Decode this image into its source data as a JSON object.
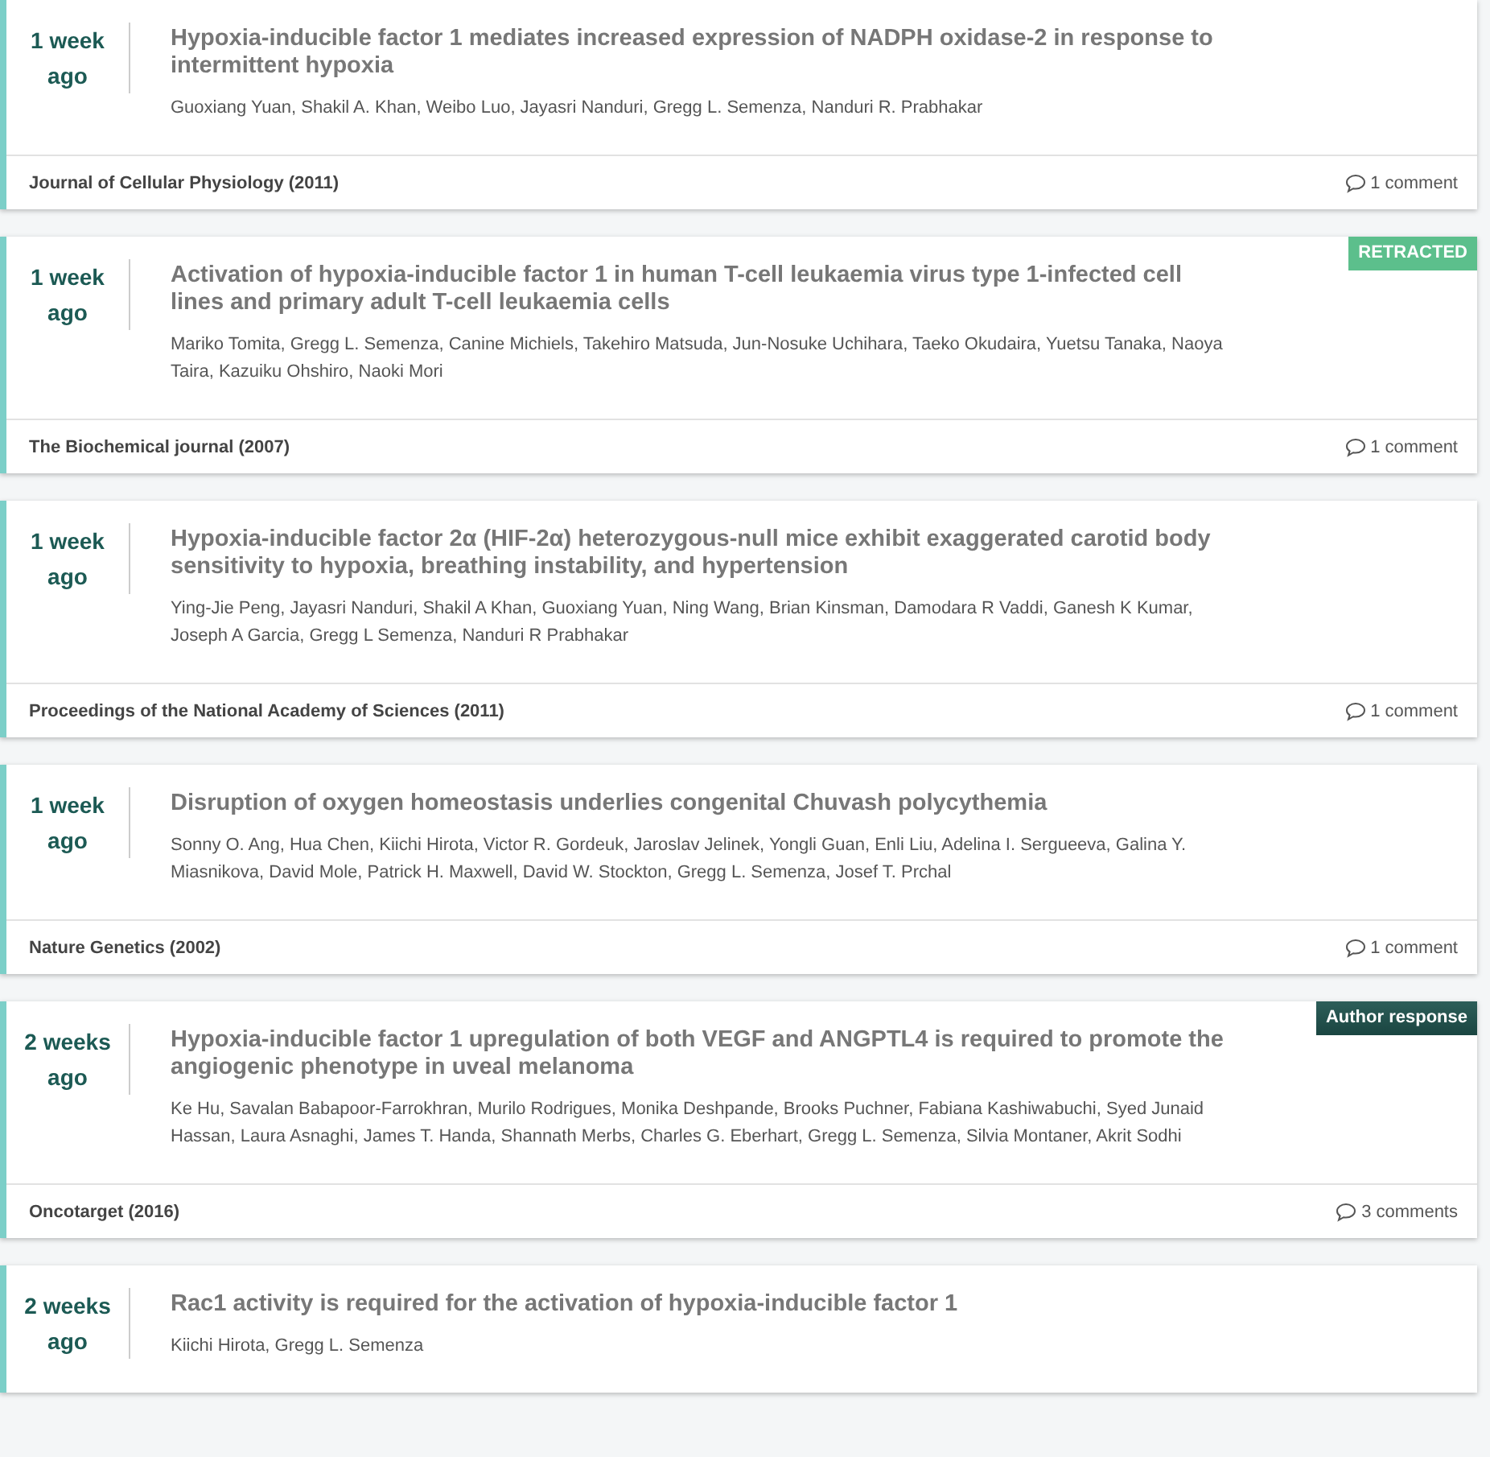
{
  "articles": [
    {
      "time": "1 week ago",
      "title": "Hypoxia-inducible factor 1 mediates increased expression of NADPH oxidase-2 in response to intermittent hypoxia",
      "authors": "Guoxiang Yuan, Shakil A. Khan, Weibo Luo, Jayasri Nanduri, Gregg L. Semenza, Nanduri R. Prabhakar",
      "journal": "Journal of Cellular Physiology (2011)",
      "comments": "1 comment"
    },
    {
      "time": "1 week ago",
      "title": "Activation of hypoxia-inducible factor 1 in human T-cell leukaemia virus type 1-infected cell lines and primary adult T-cell leukaemia cells",
      "authors": "Mariko Tomita, Gregg L. Semenza, Canine Michiels, Takehiro Matsuda, Jun-Nosuke Uchihara, Taeko Okudaira, Yuetsu Tanaka, Naoya Taira, Kazuiku Ohshiro, Naoki Mori",
      "journal": "The Biochemical journal (2007)",
      "comments": "1 comment",
      "badge": {
        "kind": "retracted",
        "text": "RETRACTED"
      }
    },
    {
      "time": "1 week ago",
      "title": "Hypoxia-inducible factor 2α (HIF-2α) heterozygous-null mice exhibit exaggerated carotid body sensitivity to hypoxia, breathing instability, and hypertension",
      "authors": "Ying-Jie Peng, Jayasri Nanduri, Shakil A Khan, Guoxiang Yuan, Ning Wang, Brian Kinsman, Damodara R Vaddi, Ganesh K Kumar, Joseph A Garcia, Gregg L Semenza, Nanduri R Prabhakar",
      "journal": "Proceedings of the National Academy of Sciences (2011)",
      "comments": "1 comment"
    },
    {
      "time": "1 week ago",
      "title": "Disruption of oxygen homeostasis underlies congenital Chuvash polycythemia",
      "authors": "Sonny O. Ang, Hua Chen, Kiichi Hirota, Victor R. Gordeuk, Jaroslav Jelinek, Yongli Guan, Enli Liu, Adelina I. Sergueeva, Galina Y. Miasnikova, David Mole, Patrick H. Maxwell, David W. Stockton, Gregg L. Semenza, Josef T. Prchal",
      "journal": "Nature Genetics (2002)",
      "comments": "1 comment"
    },
    {
      "time": "2 weeks ago",
      "title": "Hypoxia-inducible factor 1 upregulation of both VEGF and ANGPTL4 is required to promote the angiogenic phenotype in uveal melanoma",
      "authors": "Ke Hu, Savalan Babapoor-Farrokhran, Murilo Rodrigues, Monika Deshpande, Brooks Puchner, Fabiana Kashiwabuchi, Syed Junaid Hassan, Laura Asnaghi, James T. Handa, Shannath Merbs, Charles G. Eberhart, Gregg L. Semenza, Silvia Montaner, Akrit Sodhi",
      "journal": "Oncotarget (2016)",
      "comments": "3 comments",
      "badge": {
        "kind": "author_response",
        "text": "Author response"
      }
    },
    {
      "time": "2 weeks ago",
      "title": "Rac1 activity is required for the activation of hypoxia-inducible factor 1",
      "authors": "Kiichi Hirota, Gregg L. Semenza"
    }
  ]
}
